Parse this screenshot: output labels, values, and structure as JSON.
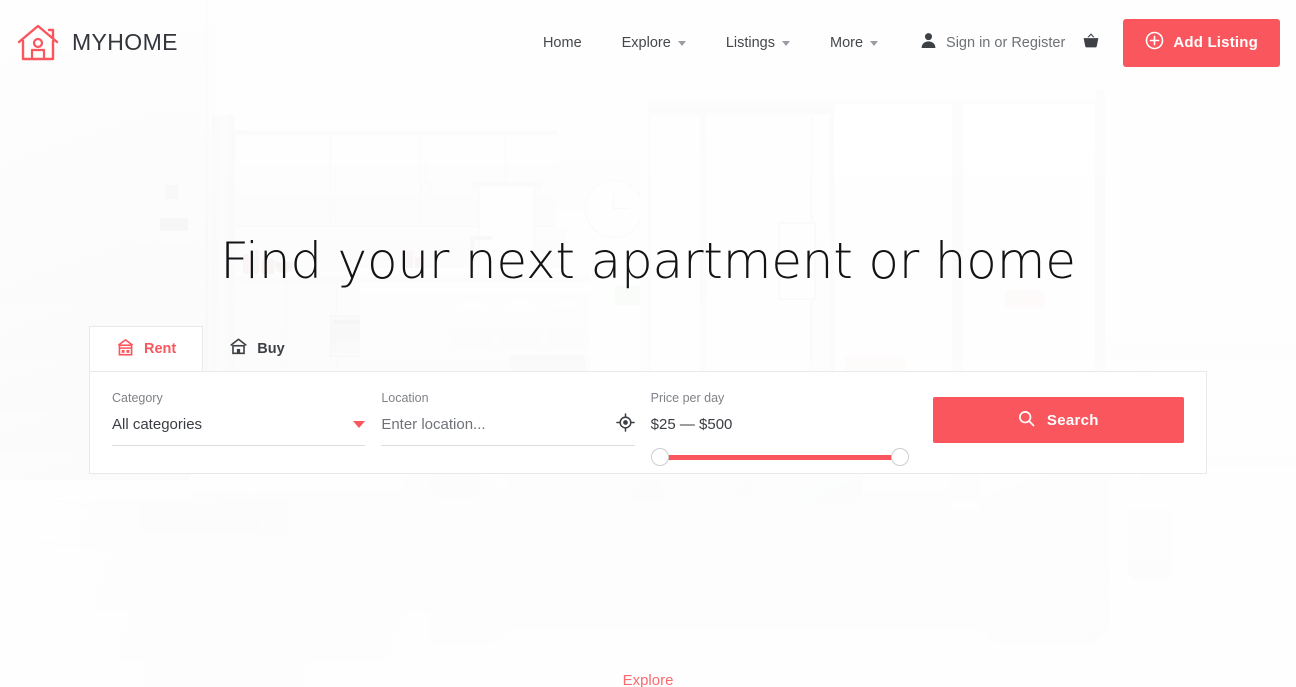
{
  "brand": {
    "name": "MYHOME",
    "accent_color": "#fa565d",
    "logo_icon": "house-outline-icon"
  },
  "header": {
    "nav_items": [
      {
        "label": "Home",
        "has_dropdown": false
      },
      {
        "label": "Explore",
        "has_dropdown": true
      },
      {
        "label": "Listings",
        "has_dropdown": true
      },
      {
        "label": "More",
        "has_dropdown": true
      }
    ],
    "auth": {
      "label": "Sign in or Register",
      "icon": "person-icon"
    },
    "basket_icon": "shopping-basket-icon",
    "add_listing": {
      "label": "Add Listing",
      "icon": "plus-circle-icon"
    }
  },
  "hero": {
    "title": "Find your next apartment or home"
  },
  "search": {
    "tabs": [
      {
        "label": "Rent",
        "icon": "house-shop-icon",
        "active": true
      },
      {
        "label": "Buy",
        "icon": "house-icon",
        "active": false
      }
    ],
    "category": {
      "label": "Category",
      "value": "All categories",
      "icon": "chevron-down-icon"
    },
    "location": {
      "label": "Location",
      "placeholder": "Enter location...",
      "value": "",
      "icon": "geolocation-crosshair-icon"
    },
    "price": {
      "label": "Price per day",
      "range_text": "$25 — $500",
      "min": 25,
      "max": 500,
      "handle_min_pct": 0,
      "handle_max_pct": 100
    },
    "submit": {
      "label": "Search",
      "icon": "search-icon"
    }
  },
  "footer": {
    "explore_label": "Explore"
  }
}
